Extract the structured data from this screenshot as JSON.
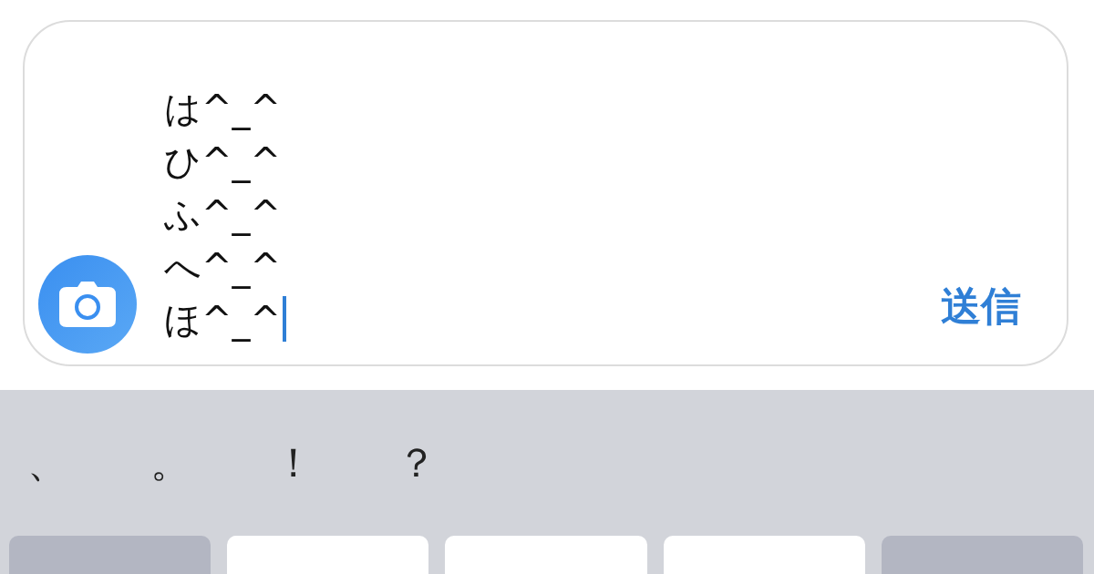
{
  "composer": {
    "value": "は^_^\nひ^_^\nふ^_^\nへ^_^\nほ^_^",
    "focused": true,
    "send_label": "送信"
  },
  "punctuation": [
    "、",
    "。",
    "！",
    "？"
  ],
  "keyboard": {
    "keys": [
      {
        "kind": "function"
      },
      {
        "kind": "letter"
      },
      {
        "kind": "letter"
      },
      {
        "kind": "letter"
      },
      {
        "kind": "function"
      }
    ]
  }
}
